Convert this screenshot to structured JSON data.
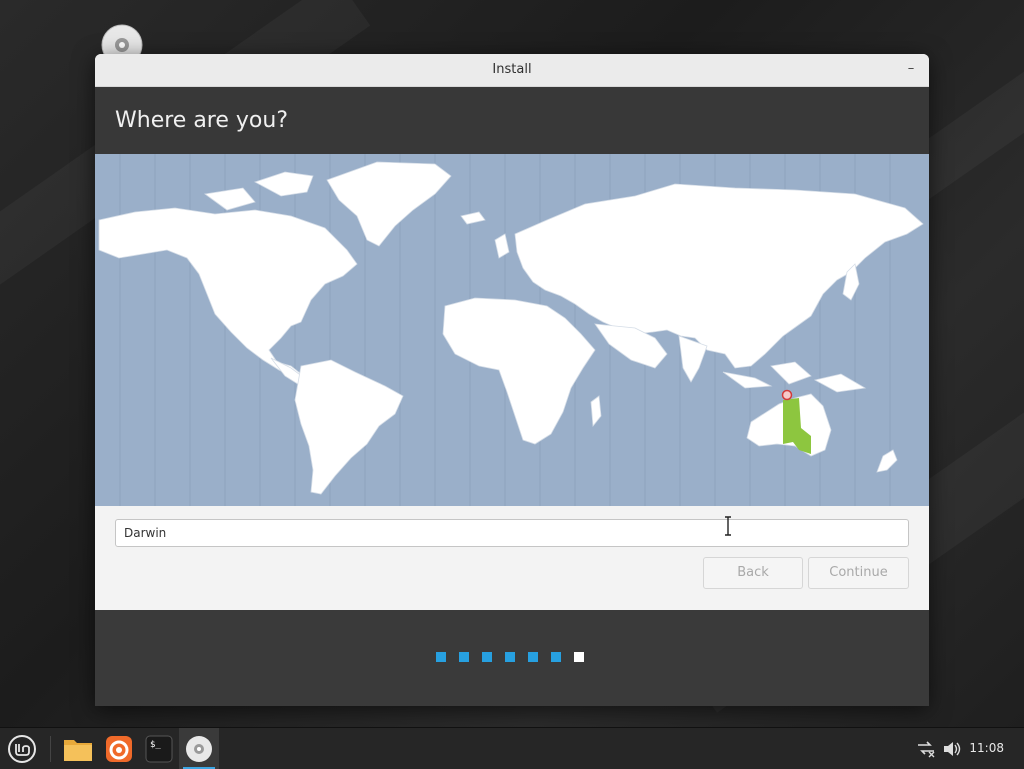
{
  "window": {
    "title": "Install",
    "minimize_glyph": "–"
  },
  "page": {
    "heading": "Where are you?"
  },
  "map": {
    "selected_city": "Darwin",
    "selected_region_color": "#8dc63f",
    "ocean_color": "#9aafc9",
    "land_color": "#ffffff"
  },
  "timezone": {
    "value": "Darwin"
  },
  "buttons": {
    "back_label": "Back",
    "continue_label": "Continue"
  },
  "progress": {
    "total_steps": 7,
    "current_step": 7,
    "done_color": "#27a0e0",
    "current_color": "#ffffff"
  },
  "taskbar": {
    "apps": [
      {
        "name": "menu",
        "icon": "linux-mint-logo-icon"
      },
      {
        "name": "files",
        "icon": "folder-icon"
      },
      {
        "name": "firefox",
        "icon": "firefox-icon"
      },
      {
        "name": "terminal",
        "icon": "terminal-icon"
      },
      {
        "name": "installer",
        "icon": "disc-icon"
      }
    ],
    "clock": "11:08"
  }
}
